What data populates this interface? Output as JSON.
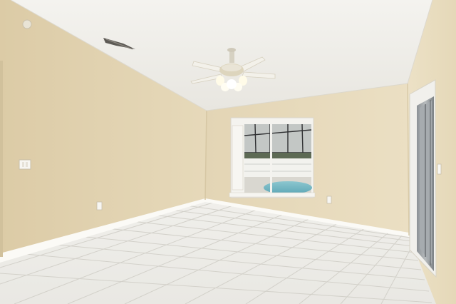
{
  "scene": {
    "subject": "empty room",
    "colors": {
      "ceiling": "#f2f1ed",
      "wall_left": "#e2d4b2",
      "wall_back": "#e6d9ba",
      "wall_right": "#ece0c4",
      "floor": "#eeedea",
      "grout": "#d4d2cc",
      "baseboard": "#fbfaf6",
      "window_frame": "#f4f3ef",
      "pool_water": "#7ab8c4",
      "fan_body": "#e9e4d6"
    }
  }
}
